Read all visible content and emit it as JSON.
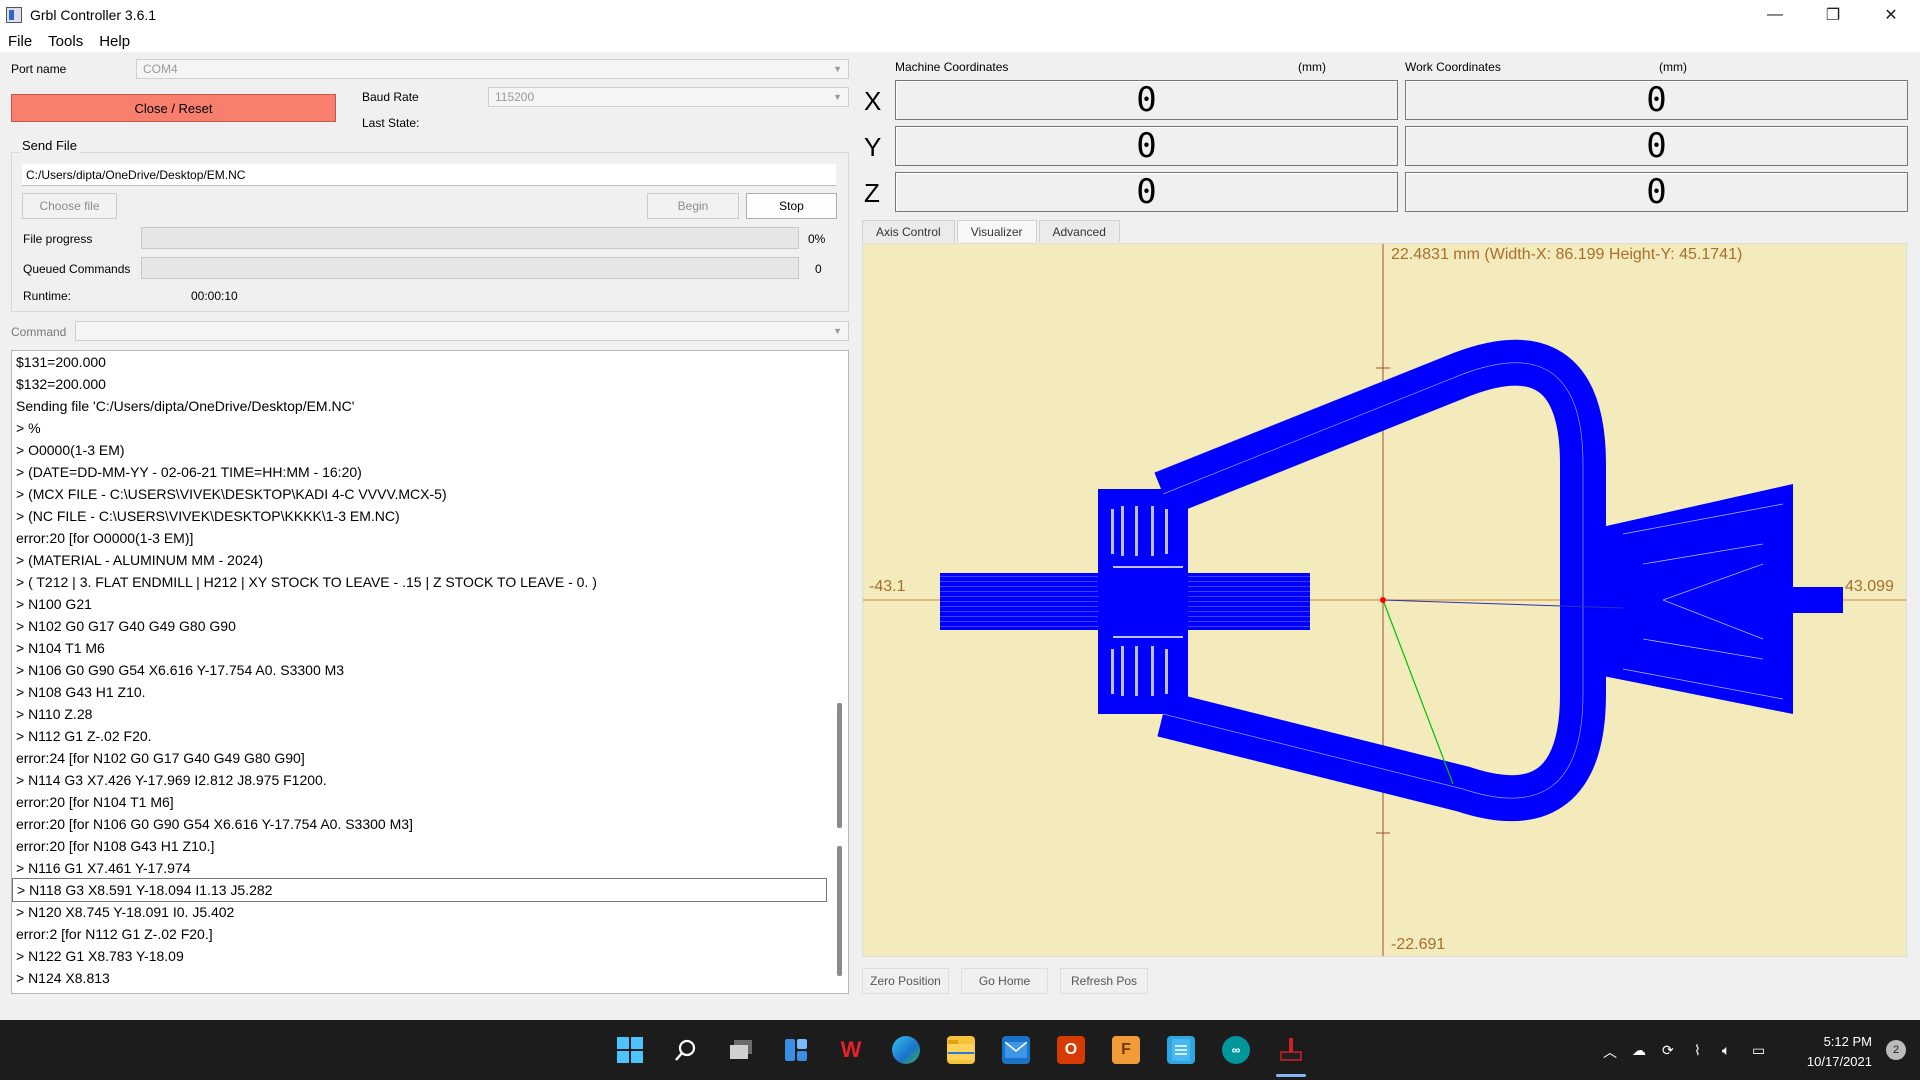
{
  "window": {
    "title": "Grbl Controller 3.6.1",
    "minimize": "—",
    "restore": "❐",
    "close": "✕"
  },
  "menu": [
    "File",
    "Tools",
    "Help"
  ],
  "connection": {
    "port_label": "Port name",
    "port_value": "COM4",
    "close_reset_label": "Close / Reset",
    "baud_label": "Baud Rate",
    "baud_value": "115200",
    "last_state_label": "Last State:",
    "last_state_value": ""
  },
  "send_file": {
    "group_title": "Send File",
    "path": "C:/Users/dipta/OneDrive/Desktop/EM.NC",
    "choose_label": "Choose file",
    "begin_label": "Begin",
    "stop_label": "Stop",
    "file_progress_label": "File progress",
    "file_progress_value": "0%",
    "file_progress_fraction": 0,
    "queued_label": "Queued Commands",
    "queued_value": "0",
    "runtime_label": "Runtime:",
    "runtime_value": "00:00:10"
  },
  "command": {
    "label": "Command",
    "value": ""
  },
  "console": {
    "lines": [
      "$131=200.000",
      "$132=200.000",
      "Sending file 'C:/Users/dipta/OneDrive/Desktop/EM.NC'",
      "> %",
      "> O0000(1-3 EM)",
      "> (DATE=DD-MM-YY - 02-06-21 TIME=HH:MM - 16:20)",
      "> (MCX FILE - C:\\USERS\\VIVEK\\DESKTOP\\KADI 4-C VVVV.MCX-5)",
      "> (NC FILE - C:\\USERS\\VIVEK\\DESKTOP\\KKKK\\1-3 EM.NC)",
      "error:20 [for O0000(1-3 EM)]",
      "> (MATERIAL - ALUMINUM MM - 2024)",
      "> ( T212 |    3. FLAT ENDMILL | H212 | XY STOCK TO LEAVE - .15 | Z STOCK TO LEAVE - 0. )",
      "> N100 G21",
      "> N102 G0 G17 G40 G49 G80 G90",
      "> N104 T1 M6",
      "> N106 G0 G90 G54 X6.616 Y-17.754 A0. S3300 M3",
      "> N108 G43 H1 Z10.",
      "> N110 Z.28",
      "> N112 G1 Z-.02 F20.",
      "error:24 [for N102 G0 G17 G40 G49 G80 G90]",
      "> N114 G3 X7.426 Y-17.969 I2.812 J8.975 F1200.",
      "error:20 [for N104 T1 M6]",
      "error:20 [for N106 G0 G90 G54 X6.616 Y-17.754 A0. S3300 M3]",
      "error:20 [for N108 G43 H1 Z10.]",
      "> N116 G1 X7.461 Y-17.974",
      "> N118 G3 X8.591 Y-18.094 I1.13 J5.282",
      "> N120 X8.745 Y-18.091 I0. J5.402",
      "error:2 [for N112 G1 Z-.02 F20.]",
      "> N122 G1 X8.783 Y-18.09",
      "> N124 X8.813"
    ],
    "selected_index": 24
  },
  "coords": {
    "machine_title": "Machine Coordinates",
    "machine_unit": "(mm)",
    "work_title": "Work Coordinates",
    "work_unit": "(mm)",
    "axes": [
      "X",
      "Y",
      "Z"
    ],
    "machine_values": [
      "0",
      "0",
      "0"
    ],
    "work_values": [
      "0",
      "0",
      "0"
    ]
  },
  "tabs": [
    "Axis Control",
    "Visualizer",
    "Advanced"
  ],
  "selected_tab": "Visualizer",
  "visualizer": {
    "top_info": "22.4831 mm  (Width-X: 86.199  Height-Y: 45.1741)",
    "left_value": "-43.1",
    "right_value": "43.099",
    "bottom_value": "-22.691",
    "background_color": "#f4ebbc",
    "toolpath_color": "#0000ff",
    "axis_color": "#a0522d"
  },
  "bottom_buttons": [
    "Zero Position",
    "Go Home",
    "Refresh Pos"
  ],
  "taskbar": {
    "icons": [
      "windows-start-icon",
      "search-icon",
      "task-view-icon",
      "widgets-icon",
      "wps-office-icon",
      "edge-browser-icon",
      "file-explorer-icon",
      "mail-icon",
      "office-icon",
      "fusion-icon",
      "notepad-icon",
      "arduino-icon",
      "grbl-controller-icon"
    ],
    "time": "5:12 PM",
    "date": "10/17/2021",
    "notifications": "2"
  }
}
